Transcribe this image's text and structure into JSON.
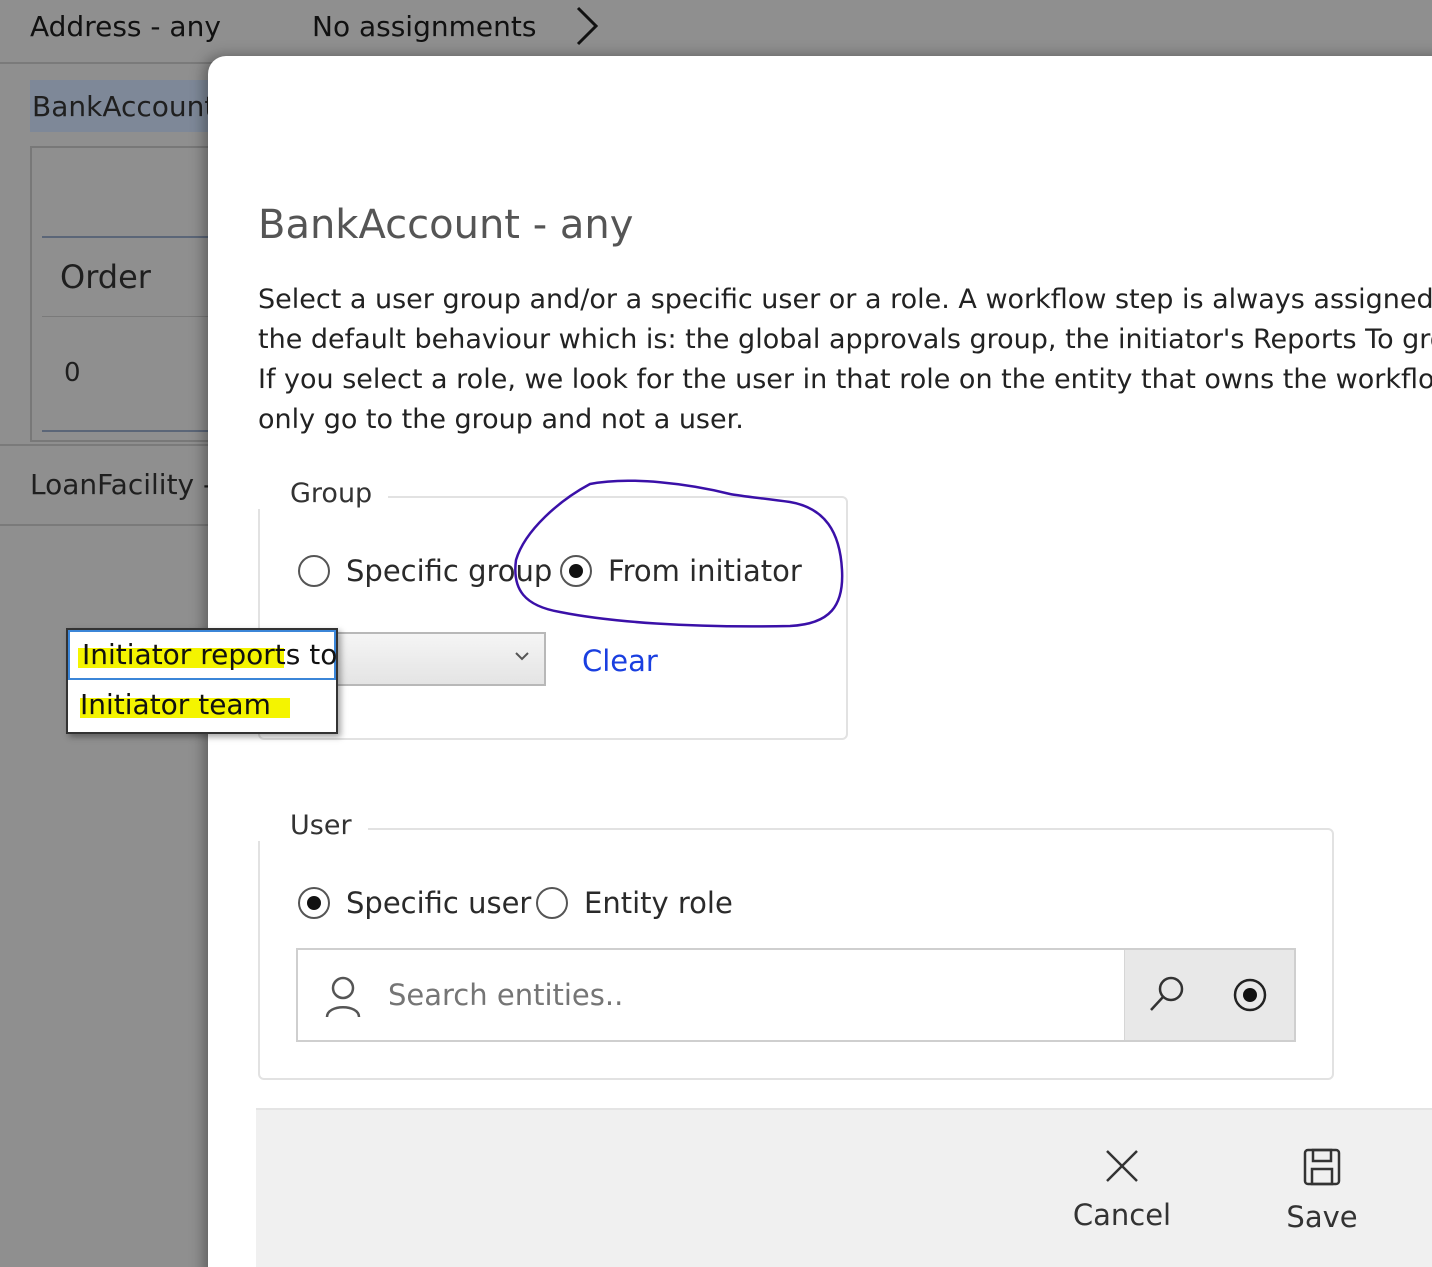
{
  "background": {
    "rows": [
      {
        "name": "Address - any",
        "assignments": "No assignments"
      },
      {
        "name": "BankAccount"
      },
      {
        "name": "LoanFacility -"
      }
    ],
    "table": {
      "header": "Order",
      "cell": "0"
    }
  },
  "modal": {
    "title": "BankAccount - any",
    "description": [
      "Select a user group and/or a specific user or a role. A workflow step is always assigned a g",
      "the default behaviour which is: the global approvals group, the initiator's Reports To grou",
      "If you select a role, we look for the user in that role on the entity that owns the workflow;",
      "only go to the group and not a user."
    ],
    "group": {
      "legend": "Group",
      "options": [
        {
          "label": "Specific group",
          "selected": false
        },
        {
          "label": "From initiator",
          "selected": true
        }
      ],
      "select_value": "",
      "clear_label": "Clear",
      "dropdown_options": [
        "Initiator reports to",
        "Initiator team"
      ]
    },
    "user": {
      "legend": "User",
      "options": [
        {
          "label": "Specific user",
          "selected": true
        },
        {
          "label": "Entity role",
          "selected": false
        }
      ],
      "search_placeholder": "Search entities.."
    },
    "footer": {
      "cancel_label": "Cancel",
      "save_label": "Save"
    }
  },
  "colors": {
    "link": "#1a3fe0",
    "annotation_circle": "#3a10a8",
    "highlight": "#f4f400"
  },
  "icons": [
    "chevron-right-icon",
    "chevron-down-icon",
    "user-icon",
    "search-icon",
    "radio-target-icon",
    "close-icon",
    "save-icon"
  ]
}
